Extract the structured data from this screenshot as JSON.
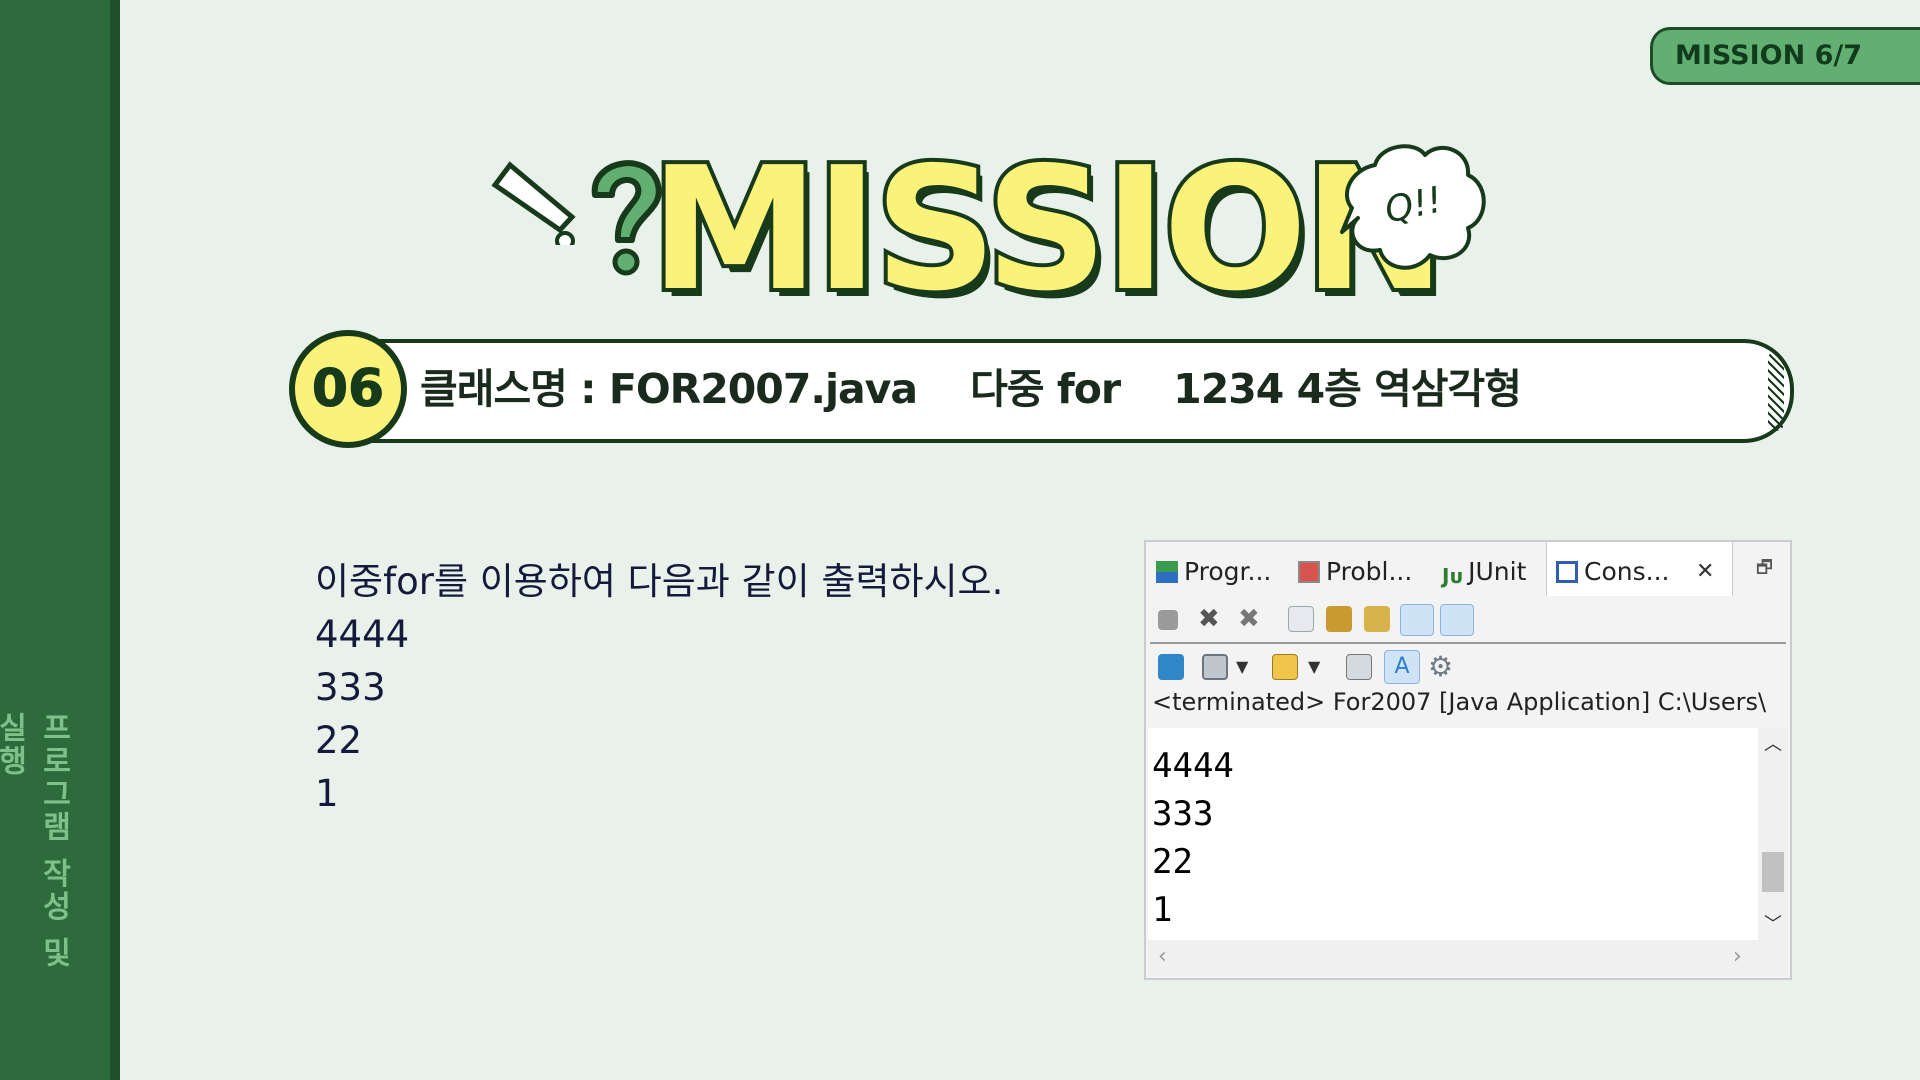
{
  "sidebar": {
    "label": "프로그램 작성 및 실행"
  },
  "badge": {
    "text": "MISSION 6/7"
  },
  "logo": {
    "text": "MISSION",
    "bubble_text": "Q!!"
  },
  "mission": {
    "number": "06",
    "title": "클래스명 : FOR2007.java    다중 for    1234 4층 역삼각형"
  },
  "instructions": {
    "prompt": "이중for를 이용하여 다음과 같이 출력하시오.",
    "lines": [
      "4444",
      "333",
      "22",
      "1"
    ]
  },
  "console": {
    "tabs": [
      {
        "label": "Progr...",
        "icon": "progress-icon"
      },
      {
        "label": "Probl...",
        "icon": "problems-icon"
      },
      {
        "label": "JUnit",
        "icon": "junit-icon"
      },
      {
        "label": "Cons...",
        "icon": "console-icon"
      }
    ],
    "close_glyph": "✕",
    "restore_glyph": "🗗",
    "status": "<terminated> For2007 [Java Application] C:\\Users\\",
    "output": [
      "4444",
      "333",
      "22",
      "1"
    ]
  },
  "colors": {
    "background": "#e8f1ea",
    "sidebar": "#2e6b3c",
    "logo_fill": "#fbf27a",
    "outline": "#173a1a",
    "badge": "#61b071"
  }
}
